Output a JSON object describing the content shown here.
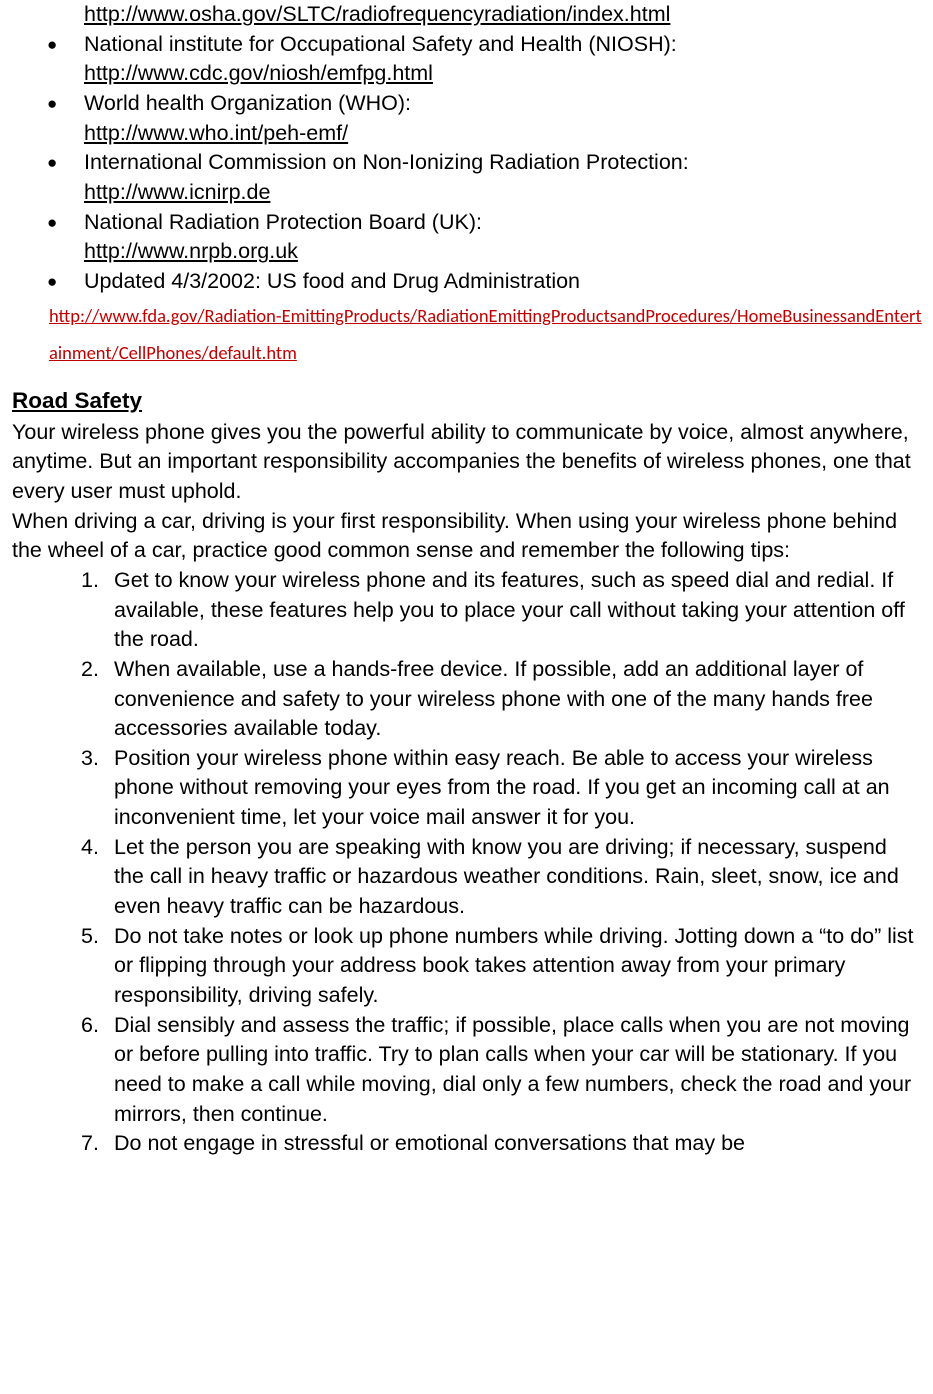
{
  "top_link": "http://www.osha.gov/SLTC/radiofrequencyradiation/index.html",
  "bullets": [
    {
      "text": "National institute for Occupational Safety and Health (NIOSH):",
      "link": "http://www.cdc.gov/niosh/emfpg.html "
    },
    {
      "text": "World health Organization (WHO):",
      "link": "http://www.who.int/peh-emf/"
    },
    {
      "text": "International Commission on Non-Ionizing Radiation Protection:",
      "link": "http://www.icnirp.de"
    },
    {
      "text": "National Radiation Protection Board (UK):",
      "link": "http://www.nrpb.org.uk"
    },
    {
      "text": "Updated 4/3/2002: US food and Drug Administration",
      "fda_link": "http://www.fda.gov/Radiation-EmittingProducts/RadiationEmittingProductsandProcedures/HomeBusinessandEntertainment/CellPhones/default.htm"
    }
  ],
  "heading": "Road Safety",
  "para1": "Your wireless phone gives you the powerful ability to communicate by voice, almost anywhere, anytime. But an important responsibility accompanies the benefits of wireless phones, one that every user must uphold.",
  "para2": "When driving a car, driving is your first responsibility. When using your wireless phone behind the wheel of a car, practice good common sense and remember the following tips:",
  "tips": [
    "Get to know your wireless phone and its features, such as speed dial and redial. If available, these features help you to place your call without taking your attention off the road.",
    "When available, use a hands-free device. If possible, add an additional layer of convenience and safety to your wireless phone with one of the many hands free accessories available today.",
    "Position your wireless phone within easy reach. Be able to access your wireless phone without removing your eyes from the road. If you get an incoming call at an inconvenient time, let your voice mail answer it for you.",
    "Let the person you are speaking with know you are driving; if necessary, suspend the call in heavy traffic or hazardous weather conditions. Rain, sleet, snow, ice and even heavy traffic can be hazardous.",
    "Do not take notes or look up phone numbers while driving. Jotting down a “to do” list or flipping through your address book takes attention away from your primary responsibility, driving safely.",
    "Dial sensibly and assess the traffic; if possible, place calls when you are not moving or before pulling into traffic. Try to plan calls when your car will be stationary. If you need to make a call while moving, dial only a few numbers, check the road and your mirrors, then continue.",
    "Do not engage in stressful or emotional conversations that may be"
  ]
}
